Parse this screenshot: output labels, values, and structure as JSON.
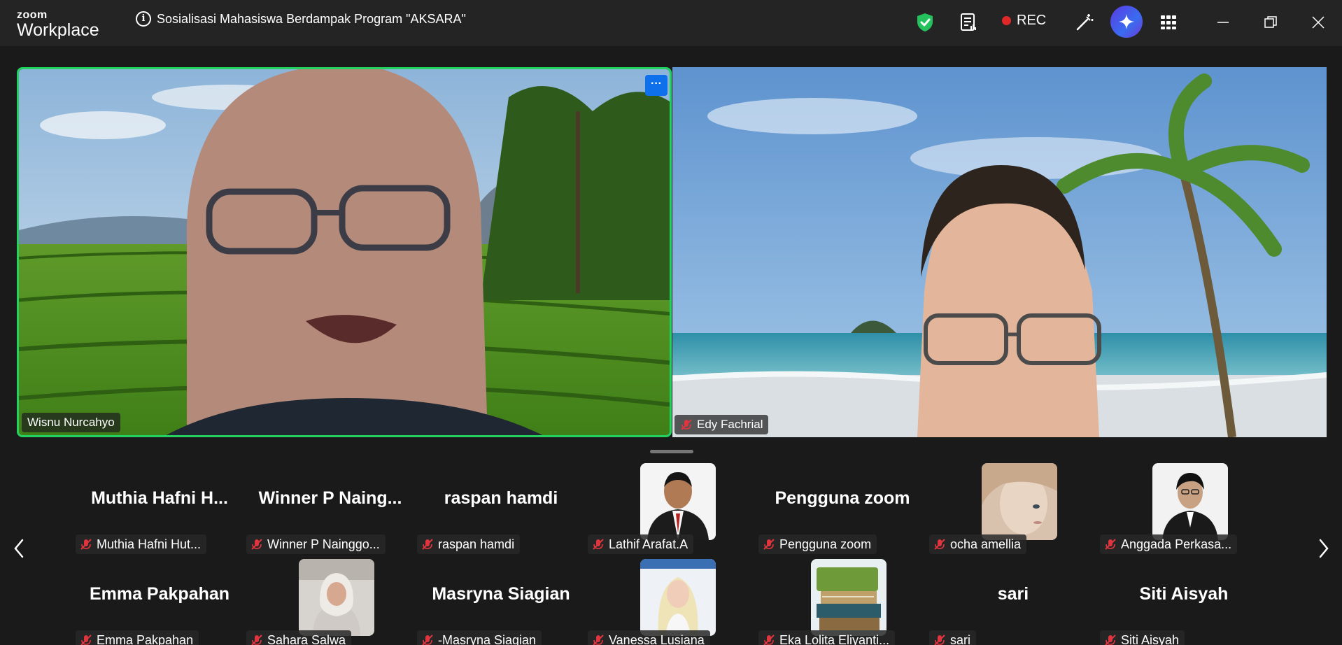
{
  "app": {
    "logo_top": "zoom",
    "logo_bottom": "Workplace",
    "meeting_title": "Sosialisasi Mahasiswa Berdampak Program \"AKSARA\"",
    "rec_label": "REC",
    "icons": [
      "shield-check-icon",
      "notes-icon",
      "record-icon",
      "magic-wand-icon",
      "ai-companion-icon",
      "apps-grid-icon",
      "minimize-icon",
      "maximize-icon",
      "close-icon"
    ]
  },
  "colors": {
    "active_speaker_border": "#23d160",
    "rec_dot": "#e02828",
    "more_button": "#0e71eb",
    "shield": "#23c25d",
    "mute_icon": "#e0343e"
  },
  "speakers": [
    {
      "name": "Wisnu Nurcahyo",
      "muted": false,
      "active": true
    },
    {
      "name": "Edy Fachrial",
      "muted": true,
      "active": false
    }
  ],
  "more_button_label": "···",
  "gallery": {
    "row1": [
      {
        "big": "Muthia Hafni H...",
        "tag": "Muthia Hafni Hut...",
        "photo": false
      },
      {
        "big": "Winner P Naing...",
        "tag": "Winner P Nainggo...",
        "photo": false
      },
      {
        "big": "raspan hamdi",
        "tag": "raspan hamdi",
        "photo": false
      },
      {
        "big": "",
        "tag": "Lathif Arafat.A",
        "photo": true
      },
      {
        "big": "Pengguna zoom",
        "tag": "Pengguna zoom",
        "photo": false
      },
      {
        "big": "",
        "tag": "ocha amellia",
        "photo": true
      },
      {
        "big": "",
        "tag": "Anggada Perkasa...",
        "photo": true
      }
    ],
    "row2": [
      {
        "big": "Emma Pakpahan",
        "tag": "Emma Pakpahan",
        "photo": false
      },
      {
        "big": "",
        "tag": "Sahara Salwa",
        "photo": true
      },
      {
        "big": "Masryna Siagian",
        "tag": "-Masryna Siagian",
        "photo": false
      },
      {
        "big": "",
        "tag": "Vanessa Lusiana",
        "photo": true
      },
      {
        "big": "",
        "tag": "Eka Lolita Eliyanti...",
        "photo": true
      },
      {
        "big": "sari",
        "tag": "sari",
        "photo": false
      },
      {
        "big": "Siti Aisyah",
        "tag": "Siti Aisyah",
        "photo": false
      }
    ]
  }
}
